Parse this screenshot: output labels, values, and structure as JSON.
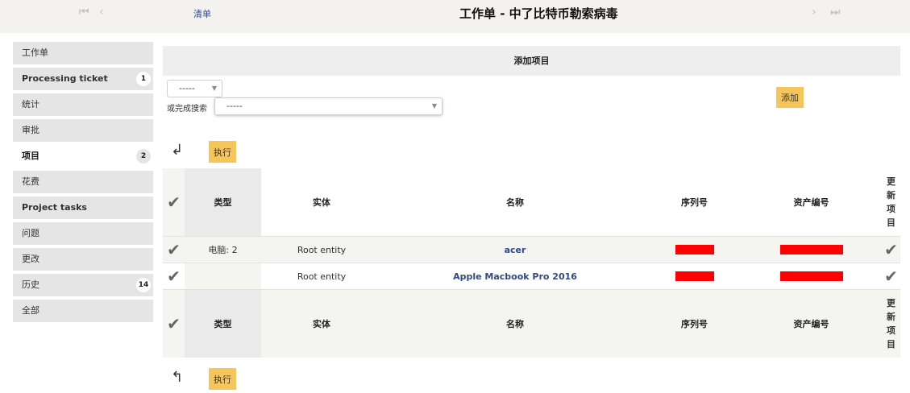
{
  "topbar": {
    "first_icon": "⏮",
    "prev_icon": "‹",
    "list_link": "清单",
    "title": "工作单 - 中了比特币勒索病毒",
    "next_icon": "›",
    "last_icon": "⏭"
  },
  "sidebar": {
    "items": [
      {
        "label": "工作单",
        "badge": ""
      },
      {
        "label": "Processing ticket",
        "badge": "1"
      },
      {
        "label": "统计",
        "badge": ""
      },
      {
        "label": "审批",
        "badge": ""
      },
      {
        "label": "项目",
        "badge": "2",
        "active": true
      },
      {
        "label": "花费",
        "badge": ""
      },
      {
        "label": "Project tasks",
        "badge": ""
      },
      {
        "label": "问题",
        "badge": ""
      },
      {
        "label": "更改",
        "badge": ""
      },
      {
        "label": "历史",
        "badge": "14"
      },
      {
        "label": "全部",
        "badge": ""
      }
    ]
  },
  "add_section": {
    "header": "添加项目",
    "type_select": "-----",
    "search_label": "或完成搜索",
    "search_select": "-----",
    "add_button": "添加"
  },
  "actions": {
    "execute_label": "执行"
  },
  "table": {
    "headers": {
      "type": "类型",
      "entity": "实体",
      "name": "名称",
      "serial": "序列号",
      "asset": "资产编号",
      "update": [
        "更",
        "新",
        "项",
        "目"
      ]
    },
    "group_label": "电脑: 2",
    "rows": [
      {
        "entity": "Root entity",
        "name": "acer",
        "serial": "[redacted]",
        "asset": "[redacted]"
      },
      {
        "entity": "Root entity",
        "name": "Apple Macbook Pro 2016",
        "serial": "[redacted]",
        "asset": "[redacted]"
      }
    ]
  },
  "colors": {
    "accent_yellow": "#f7c65a",
    "link_blue": "#2e4a8a",
    "redaction_red": "#ff0000"
  }
}
